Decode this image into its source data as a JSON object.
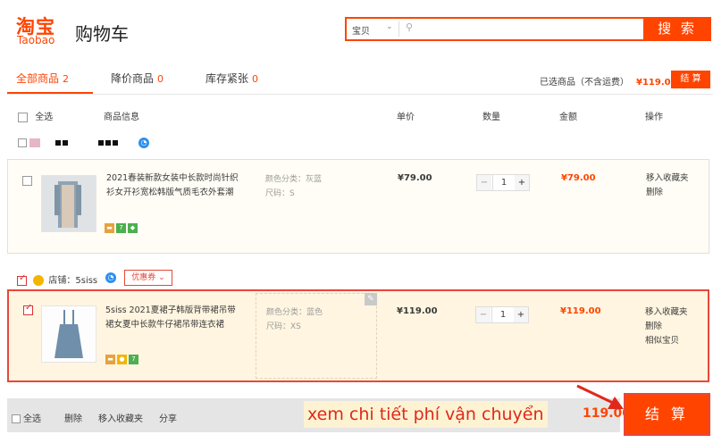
{
  "header": {
    "logo_cn": "淘宝",
    "logo_en": "Taobao",
    "title": "购物车",
    "search": {
      "scope": "宝贝",
      "value": "",
      "button": "搜 索"
    }
  },
  "tabs": [
    {
      "label": "全部商品",
      "count": "2"
    },
    {
      "label": "降价商品",
      "count": "0"
    },
    {
      "label": "库存紧张",
      "count": "0"
    }
  ],
  "selected": {
    "label": "已选商品（不含运费）",
    "amount": "¥119.00",
    "settle": "结 算"
  },
  "columns": {
    "select_all": "全选",
    "info": "商品信息",
    "unit_price": "单价",
    "quantity": "数量",
    "amount": "金额",
    "ops": "操作"
  },
  "items": [
    {
      "title": "2021春装新款女装中长款时尚针织衫女开衫宽松韩版气质毛衣外套潮",
      "color": "颜色分类：灰蓝",
      "size": "尺码：S",
      "price": "¥79.00",
      "qty": "1",
      "amount": "¥79.00",
      "ops": [
        "移入收藏夹",
        "删除"
      ]
    },
    {
      "title": "5siss 2021夏裙子韩版背带裙吊带裙女夏中长款牛仔裙吊带连衣裙",
      "color": "颜色分类：蓝色",
      "size": "尺码：XS",
      "price": "¥119.00",
      "qty": "1",
      "amount": "¥119.00",
      "ops": [
        "移入收藏夹",
        "删除",
        "相似宝贝"
      ]
    }
  ],
  "shop2": {
    "label": "店铺：",
    "name": "5siss",
    "coupon": "优惠券"
  },
  "bottom": {
    "select_all": "全选",
    "delete": "删除",
    "move_fav": "移入收藏夹",
    "share": "分享",
    "amount": "119.00",
    "settle": "结 算",
    "overlay": "xem chi tiết phí vận chuyển"
  },
  "colors": {
    "accent": "#ff4400",
    "highlight": "#e8473a"
  }
}
